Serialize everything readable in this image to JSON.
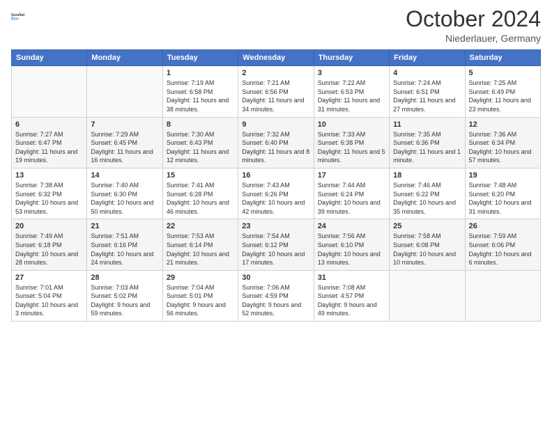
{
  "header": {
    "logo_line1": "General",
    "logo_line2": "Blue",
    "month": "October 2024",
    "location": "Niederlauer, Germany"
  },
  "days_of_week": [
    "Sunday",
    "Monday",
    "Tuesday",
    "Wednesday",
    "Thursday",
    "Friday",
    "Saturday"
  ],
  "weeks": [
    [
      {
        "day": "",
        "detail": ""
      },
      {
        "day": "",
        "detail": ""
      },
      {
        "day": "1",
        "detail": "Sunrise: 7:19 AM\nSunset: 6:58 PM\nDaylight: 11 hours and 38 minutes."
      },
      {
        "day": "2",
        "detail": "Sunrise: 7:21 AM\nSunset: 6:56 PM\nDaylight: 11 hours and 34 minutes."
      },
      {
        "day": "3",
        "detail": "Sunrise: 7:22 AM\nSunset: 6:53 PM\nDaylight: 11 hours and 31 minutes."
      },
      {
        "day": "4",
        "detail": "Sunrise: 7:24 AM\nSunset: 6:51 PM\nDaylight: 11 hours and 27 minutes."
      },
      {
        "day": "5",
        "detail": "Sunrise: 7:25 AM\nSunset: 6:49 PM\nDaylight: 11 hours and 23 minutes."
      }
    ],
    [
      {
        "day": "6",
        "detail": "Sunrise: 7:27 AM\nSunset: 6:47 PM\nDaylight: 11 hours and 19 minutes."
      },
      {
        "day": "7",
        "detail": "Sunrise: 7:29 AM\nSunset: 6:45 PM\nDaylight: 11 hours and 16 minutes."
      },
      {
        "day": "8",
        "detail": "Sunrise: 7:30 AM\nSunset: 6:43 PM\nDaylight: 11 hours and 12 minutes."
      },
      {
        "day": "9",
        "detail": "Sunrise: 7:32 AM\nSunset: 6:40 PM\nDaylight: 11 hours and 8 minutes."
      },
      {
        "day": "10",
        "detail": "Sunrise: 7:33 AM\nSunset: 6:38 PM\nDaylight: 11 hours and 5 minutes."
      },
      {
        "day": "11",
        "detail": "Sunrise: 7:35 AM\nSunset: 6:36 PM\nDaylight: 11 hours and 1 minute."
      },
      {
        "day": "12",
        "detail": "Sunrise: 7:36 AM\nSunset: 6:34 PM\nDaylight: 10 hours and 57 minutes."
      }
    ],
    [
      {
        "day": "13",
        "detail": "Sunrise: 7:38 AM\nSunset: 6:32 PM\nDaylight: 10 hours and 53 minutes."
      },
      {
        "day": "14",
        "detail": "Sunrise: 7:40 AM\nSunset: 6:30 PM\nDaylight: 10 hours and 50 minutes."
      },
      {
        "day": "15",
        "detail": "Sunrise: 7:41 AM\nSunset: 6:28 PM\nDaylight: 10 hours and 46 minutes."
      },
      {
        "day": "16",
        "detail": "Sunrise: 7:43 AM\nSunset: 6:26 PM\nDaylight: 10 hours and 42 minutes."
      },
      {
        "day": "17",
        "detail": "Sunrise: 7:44 AM\nSunset: 6:24 PM\nDaylight: 10 hours and 39 minutes."
      },
      {
        "day": "18",
        "detail": "Sunrise: 7:46 AM\nSunset: 6:22 PM\nDaylight: 10 hours and 35 minutes."
      },
      {
        "day": "19",
        "detail": "Sunrise: 7:48 AM\nSunset: 6:20 PM\nDaylight: 10 hours and 31 minutes."
      }
    ],
    [
      {
        "day": "20",
        "detail": "Sunrise: 7:49 AM\nSunset: 6:18 PM\nDaylight: 10 hours and 28 minutes."
      },
      {
        "day": "21",
        "detail": "Sunrise: 7:51 AM\nSunset: 6:16 PM\nDaylight: 10 hours and 24 minutes."
      },
      {
        "day": "22",
        "detail": "Sunrise: 7:53 AM\nSunset: 6:14 PM\nDaylight: 10 hours and 21 minutes."
      },
      {
        "day": "23",
        "detail": "Sunrise: 7:54 AM\nSunset: 6:12 PM\nDaylight: 10 hours and 17 minutes."
      },
      {
        "day": "24",
        "detail": "Sunrise: 7:56 AM\nSunset: 6:10 PM\nDaylight: 10 hours and 13 minutes."
      },
      {
        "day": "25",
        "detail": "Sunrise: 7:58 AM\nSunset: 6:08 PM\nDaylight: 10 hours and 10 minutes."
      },
      {
        "day": "26",
        "detail": "Sunrise: 7:59 AM\nSunset: 6:06 PM\nDaylight: 10 hours and 6 minutes."
      }
    ],
    [
      {
        "day": "27",
        "detail": "Sunrise: 7:01 AM\nSunset: 5:04 PM\nDaylight: 10 hours and 3 minutes."
      },
      {
        "day": "28",
        "detail": "Sunrise: 7:03 AM\nSunset: 5:02 PM\nDaylight: 9 hours and 59 minutes."
      },
      {
        "day": "29",
        "detail": "Sunrise: 7:04 AM\nSunset: 5:01 PM\nDaylight: 9 hours and 56 minutes."
      },
      {
        "day": "30",
        "detail": "Sunrise: 7:06 AM\nSunset: 4:59 PM\nDaylight: 9 hours and 52 minutes."
      },
      {
        "day": "31",
        "detail": "Sunrise: 7:08 AM\nSunset: 4:57 PM\nDaylight: 9 hours and 49 minutes."
      },
      {
        "day": "",
        "detail": ""
      },
      {
        "day": "",
        "detail": ""
      }
    ]
  ]
}
